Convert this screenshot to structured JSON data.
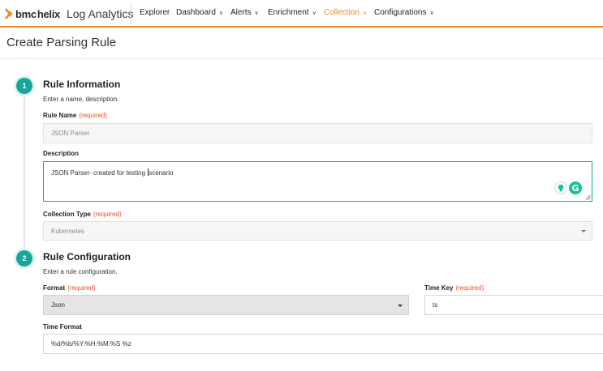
{
  "brand": {
    "bmc": "bmc",
    "helix": "helix",
    "app_name": "Log Analytics",
    "accent_color": "#f08a24"
  },
  "nav": [
    {
      "label": "Explorer",
      "has_menu": false,
      "active": false
    },
    {
      "label": "Dashboard",
      "has_menu": true,
      "active": false
    },
    {
      "label": "Alerts",
      "has_menu": true,
      "active": false
    },
    {
      "label": "Enrichment",
      "has_menu": true,
      "active": false
    },
    {
      "label": "Collection",
      "has_menu": true,
      "active": true
    },
    {
      "label": "Configurations",
      "has_menu": true,
      "active": false
    }
  ],
  "page": {
    "title": "Create Parsing Rule"
  },
  "steps": [
    {
      "number": "1",
      "title": "Rule Information",
      "subtitle": "Enter a name, description."
    },
    {
      "number": "2",
      "title": "Rule Configuration",
      "subtitle": "Enter a rule configuration."
    }
  ],
  "required_text": "(required)",
  "fields": {
    "rule_name": {
      "label": "Rule Name",
      "required": true,
      "value": "JSON Parser"
    },
    "description": {
      "label": "Description",
      "value_before_cursor": "JSON Parser- created for testing ",
      "value_after_cursor": "scenario"
    },
    "collection_type": {
      "label": "Collection Type",
      "required": true,
      "value": "Kubernetes"
    },
    "format": {
      "label": "Format",
      "required": true,
      "value": "Json"
    },
    "time_key": {
      "label": "Time Key",
      "required": true,
      "value": "ts"
    },
    "time_format": {
      "label": "Time Format",
      "value": "%d/%b/%Y:%H:%M:%S %z"
    }
  },
  "colors": {
    "step_teal": "#1aa59a",
    "required_red": "#e2522a",
    "grammarly_green": "#15c39a"
  },
  "icons": [
    "bmc-logo-icon",
    "chevron-down-icon",
    "lightbulb-icon",
    "grammarly-icon",
    "resize-grip-icon",
    "select-caret-icon"
  ]
}
